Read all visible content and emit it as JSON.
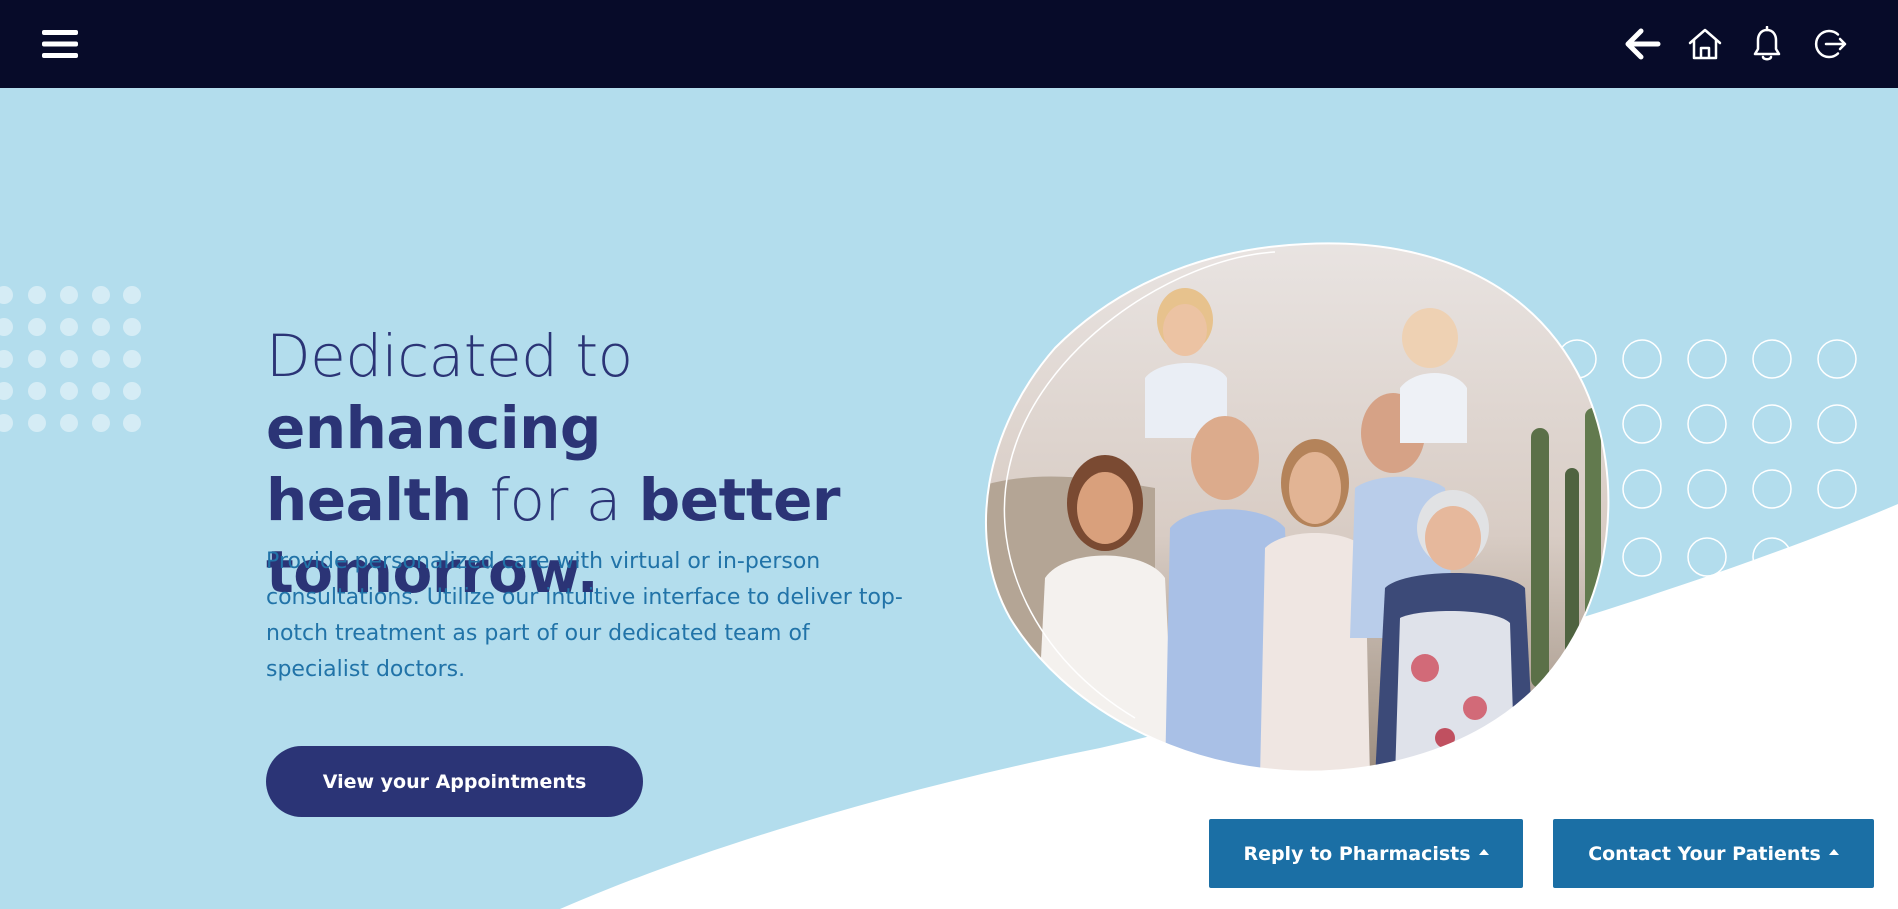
{
  "topbar": {
    "icons": [
      "menu-icon",
      "back-arrow-icon",
      "home-icon",
      "bell-icon",
      "logout-icon"
    ]
  },
  "hero": {
    "headline": {
      "part1": "Dedicated to ",
      "part2": "enhancing",
      "part3": "health",
      "part4": " for a ",
      "part5": "better",
      "part6": "tomorrow."
    },
    "subtext": "Provide personalized care with virtual or in-person consultations. Utilize our intuitive interface to deliver top-notch treatment as part of our dedicated team of specialist doctors.",
    "primary_button": "View your Appointments",
    "image_alt": "family photo"
  },
  "actions": {
    "reply_pharmacists": "Reply to Pharmacists",
    "contact_patients": "Contact Your Patients"
  },
  "colors": {
    "topbar": "#070b29",
    "hero_bg": "#b3dded",
    "headline": "#2b3476",
    "subtext": "#2173a8",
    "primary_button": "#2b3476",
    "action_button": "#1b6fa5"
  }
}
